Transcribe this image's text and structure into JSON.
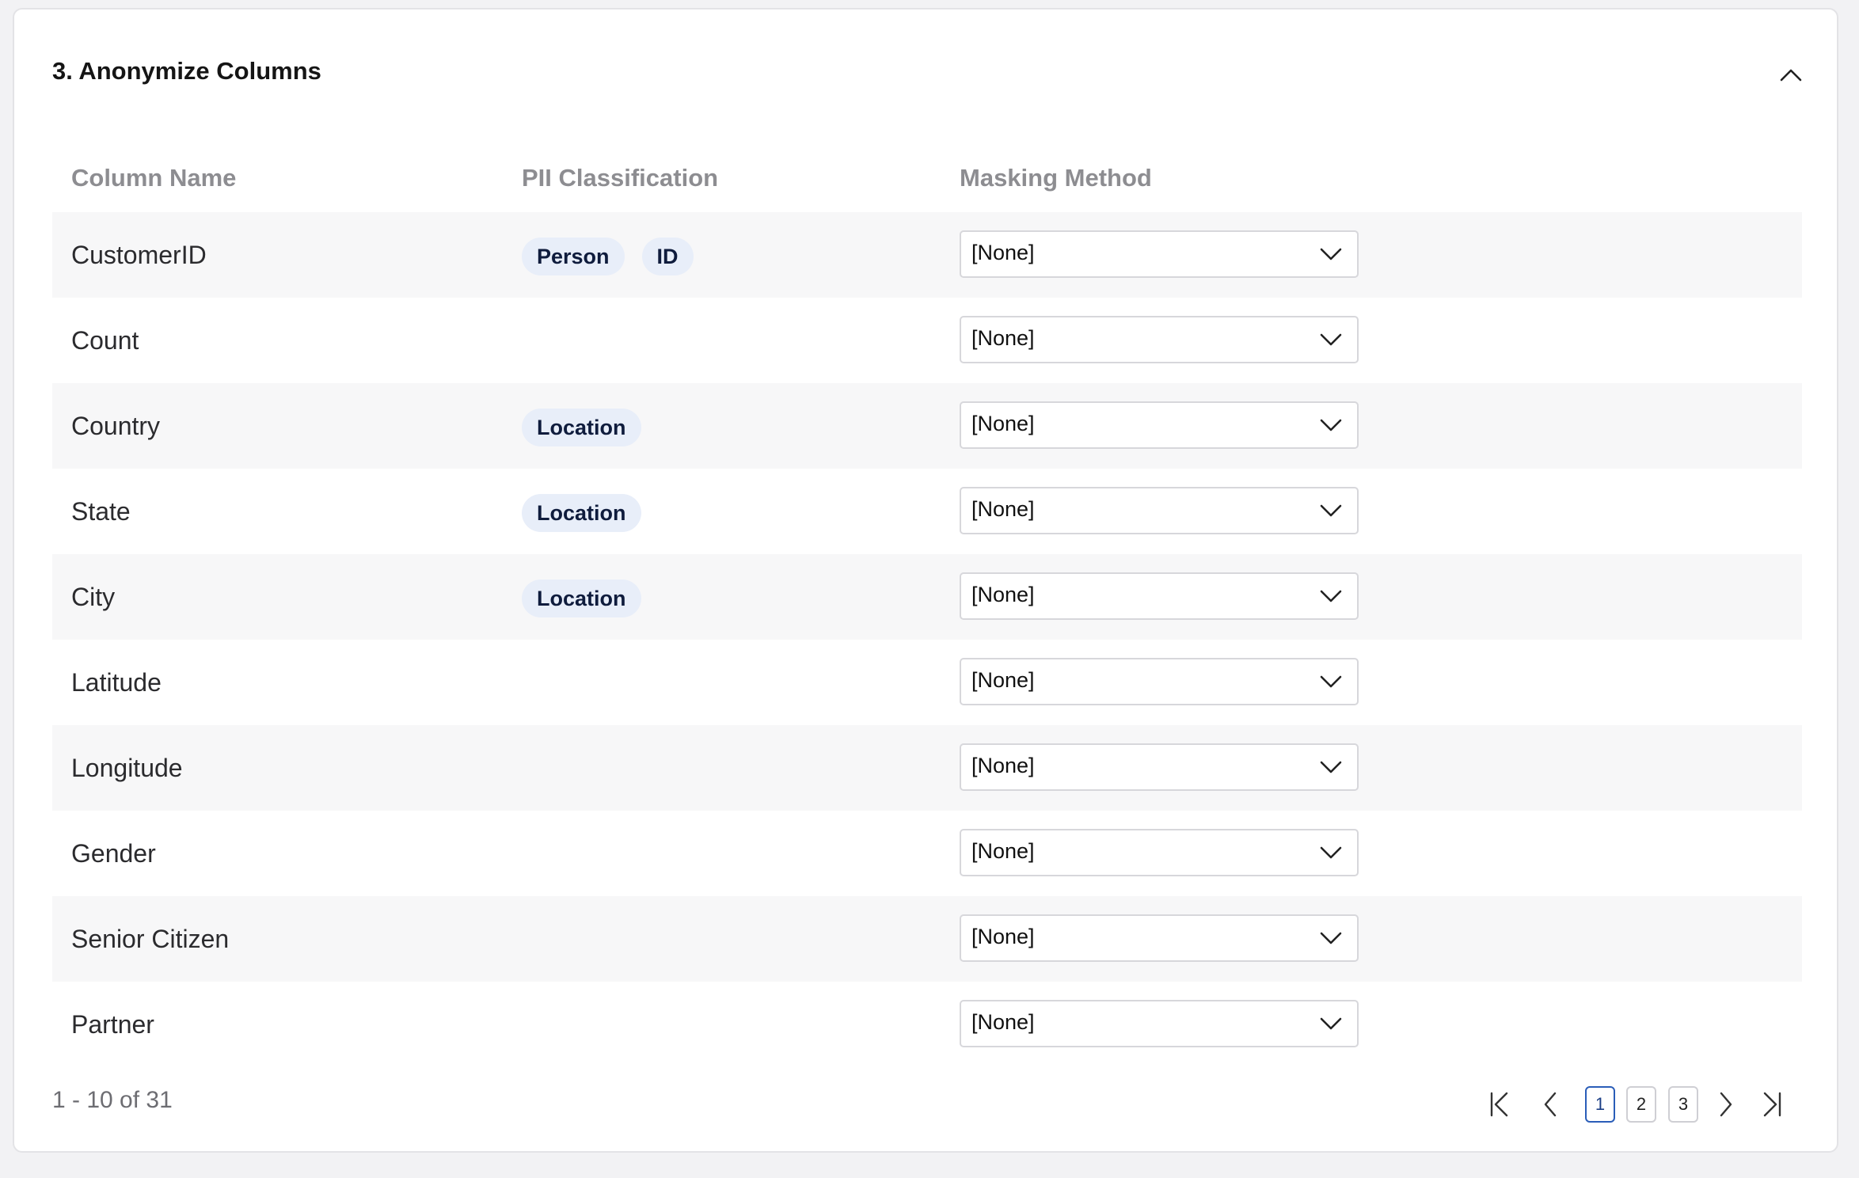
{
  "section": {
    "title": "3. Anonymize Columns"
  },
  "table": {
    "headers": {
      "column_name": "Column Name",
      "pii_classification": "PII Classification",
      "masking_method": "Masking Method"
    },
    "rows": [
      {
        "name": "CustomerID",
        "tags": [
          "Person",
          "ID"
        ],
        "masking": "[None]"
      },
      {
        "name": "Count",
        "tags": [],
        "masking": "[None]"
      },
      {
        "name": "Country",
        "tags": [
          "Location"
        ],
        "masking": "[None]"
      },
      {
        "name": "State",
        "tags": [
          "Location"
        ],
        "masking": "[None]"
      },
      {
        "name": "City",
        "tags": [
          "Location"
        ],
        "masking": "[None]"
      },
      {
        "name": "Latitude",
        "tags": [],
        "masking": "[None]"
      },
      {
        "name": "Longitude",
        "tags": [],
        "masking": "[None]"
      },
      {
        "name": "Gender",
        "tags": [],
        "masking": "[None]"
      },
      {
        "name": "Senior Citizen",
        "tags": [],
        "masking": "[None]"
      },
      {
        "name": "Partner",
        "tags": [],
        "masking": "[None]"
      }
    ]
  },
  "pagination": {
    "summary": "1 - 10 of 31",
    "pages": [
      "1",
      "2",
      "3"
    ],
    "current_page": "1"
  },
  "colors": {
    "tag_bg": "#e8eef9",
    "tag_text": "#0f1c3d",
    "active_page_border": "#2a5db8",
    "row_shade": "#f7f7f8"
  },
  "icons": {
    "collapse": "chevron-up-icon",
    "select": "chevron-down-icon",
    "first": "first-page-icon",
    "prev": "chevron-left-icon",
    "next": "chevron-right-icon",
    "last": "last-page-icon"
  }
}
